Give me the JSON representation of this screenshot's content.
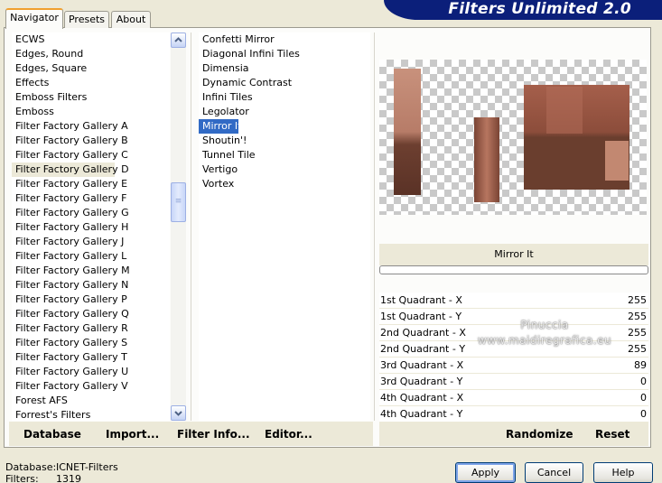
{
  "app": {
    "title": "Filters Unlimited 2.0"
  },
  "tabs": [
    {
      "label": "Navigator",
      "active": true
    },
    {
      "label": "Presets",
      "active": false
    },
    {
      "label": "About",
      "active": false
    }
  ],
  "categories": [
    {
      "label": "ECWS"
    },
    {
      "label": "Edges, Round"
    },
    {
      "label": "Edges, Square"
    },
    {
      "label": "Effects"
    },
    {
      "label": "Emboss Filters"
    },
    {
      "label": "Emboss"
    },
    {
      "label": "Filter Factory Gallery A"
    },
    {
      "label": "Filter Factory Gallery B"
    },
    {
      "label": "Filter Factory Gallery C"
    },
    {
      "label": "Filter Factory Gallery D",
      "selected": true
    },
    {
      "label": "Filter Factory Gallery E"
    },
    {
      "label": "Filter Factory Gallery F"
    },
    {
      "label": "Filter Factory Gallery G"
    },
    {
      "label": "Filter Factory Gallery H"
    },
    {
      "label": "Filter Factory Gallery J"
    },
    {
      "label": "Filter Factory Gallery L"
    },
    {
      "label": "Filter Factory Gallery M"
    },
    {
      "label": "Filter Factory Gallery N"
    },
    {
      "label": "Filter Factory Gallery P"
    },
    {
      "label": "Filter Factory Gallery Q"
    },
    {
      "label": "Filter Factory Gallery R"
    },
    {
      "label": "Filter Factory Gallery S"
    },
    {
      "label": "Filter Factory Gallery T"
    },
    {
      "label": "Filter Factory Gallery U"
    },
    {
      "label": "Filter Factory Gallery V"
    },
    {
      "label": "Forest AFS"
    },
    {
      "label": "Forrest's Filters"
    }
  ],
  "filters": [
    {
      "label": "Confetti Mirror"
    },
    {
      "label": "Diagonal Infini Tiles"
    },
    {
      "label": "Dimensia"
    },
    {
      "label": "Dynamic Contrast"
    },
    {
      "label": "Infini Tiles"
    },
    {
      "label": "Legolator"
    },
    {
      "label": "Mirror It",
      "selected": true
    },
    {
      "label": "Shoutin'!"
    },
    {
      "label": "Tunnel Tile"
    },
    {
      "label": "Vertigo"
    },
    {
      "label": "Vortex"
    }
  ],
  "scrollbar": {
    "up_icon": "arrow-up-icon",
    "down_icon": "arrow-down-icon",
    "thumb_grip": "≡"
  },
  "preview": {
    "filter_name": "Mirror It",
    "progress": 0
  },
  "params": [
    {
      "label": "1st Quadrant - X",
      "value": "255"
    },
    {
      "label": "1st Quadrant - Y",
      "value": "255"
    },
    {
      "label": "2nd Quadrant - X",
      "value": "255"
    },
    {
      "label": "2nd Quadrant - Y",
      "value": "255"
    },
    {
      "label": "3rd Quadrant - X",
      "value": "89"
    },
    {
      "label": "3rd Quadrant - Y",
      "value": "0"
    },
    {
      "label": "4th Quadrant - X",
      "value": "0"
    },
    {
      "label": "4th Quadrant - Y",
      "value": "0"
    }
  ],
  "watermark": {
    "line1": "Pinuccia",
    "line2": "www.maidiregrafica.eu"
  },
  "left_toolbar": {
    "database": "Database",
    "import": "Import...",
    "filter_info": "Filter Info...",
    "editor": "Editor..."
  },
  "right_toolbar": {
    "randomize": "Randomize",
    "reset": "Reset"
  },
  "footer": {
    "database_label": "Database:",
    "database_value": "ICNET-Filters",
    "filters_label": "Filters:",
    "filters_value": "1319"
  },
  "buttons": {
    "apply": "Apply",
    "cancel": "Cancel",
    "help": "Help"
  },
  "colors": {
    "banner": "#0b1f7a",
    "selection": "#316ac5",
    "dialog_bg": "#ece9d8"
  }
}
